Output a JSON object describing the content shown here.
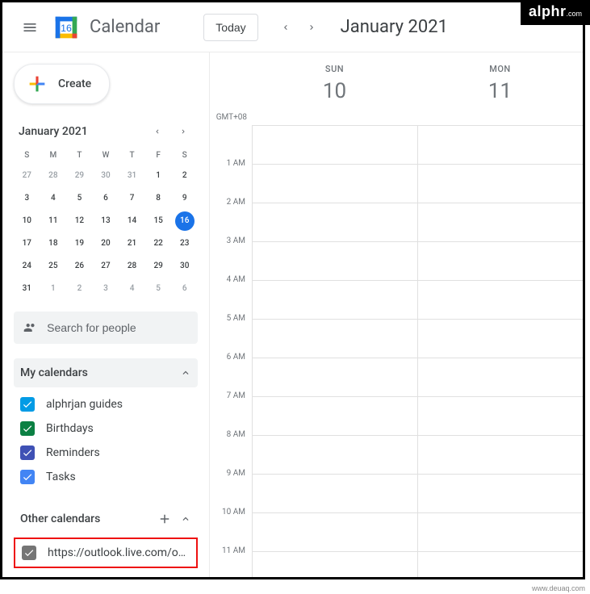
{
  "badge": {
    "brand": "alphr",
    "tld": ".com"
  },
  "watermark": "www.deuaq.com",
  "header": {
    "app_title": "Calendar",
    "today_label": "Today",
    "current_range": "January 2021"
  },
  "create_label": "Create",
  "mini_cal": {
    "title": "January 2021",
    "dow": [
      "S",
      "M",
      "T",
      "W",
      "T",
      "F",
      "S"
    ],
    "weeks": [
      [
        {
          "d": "27",
          "o": true
        },
        {
          "d": "28",
          "o": true
        },
        {
          "d": "29",
          "o": true
        },
        {
          "d": "30",
          "o": true
        },
        {
          "d": "31",
          "o": true
        },
        {
          "d": "1"
        },
        {
          "d": "2"
        }
      ],
      [
        {
          "d": "3"
        },
        {
          "d": "4"
        },
        {
          "d": "5"
        },
        {
          "d": "6"
        },
        {
          "d": "7"
        },
        {
          "d": "8"
        },
        {
          "d": "9"
        }
      ],
      [
        {
          "d": "10"
        },
        {
          "d": "11"
        },
        {
          "d": "12"
        },
        {
          "d": "13"
        },
        {
          "d": "14"
        },
        {
          "d": "15"
        },
        {
          "d": "16",
          "t": true
        }
      ],
      [
        {
          "d": "17"
        },
        {
          "d": "18"
        },
        {
          "d": "19"
        },
        {
          "d": "20"
        },
        {
          "d": "21"
        },
        {
          "d": "22"
        },
        {
          "d": "23"
        }
      ],
      [
        {
          "d": "24"
        },
        {
          "d": "25"
        },
        {
          "d": "26"
        },
        {
          "d": "27"
        },
        {
          "d": "28"
        },
        {
          "d": "29"
        },
        {
          "d": "30"
        }
      ],
      [
        {
          "d": "31"
        },
        {
          "d": "1",
          "o": true
        },
        {
          "d": "2",
          "o": true
        },
        {
          "d": "3",
          "o": true
        },
        {
          "d": "4",
          "o": true
        },
        {
          "d": "5",
          "o": true
        },
        {
          "d": "6",
          "o": true
        }
      ]
    ]
  },
  "search_placeholder": "Search for people",
  "my_calendars": {
    "title": "My calendars",
    "items": [
      {
        "label": "alphrjan guides",
        "color": "#039be5"
      },
      {
        "label": "Birthdays",
        "color": "#0b8043"
      },
      {
        "label": "Reminders",
        "color": "#3f51b5"
      },
      {
        "label": "Tasks",
        "color": "#4285f4"
      }
    ]
  },
  "other_calendars": {
    "title": "Other calendars",
    "highlighted_item": {
      "label": "https://outlook.live.com/o…",
      "color": "#757575"
    }
  },
  "timezone": "GMT+08",
  "days": [
    {
      "dow": "SUN",
      "num": "10"
    },
    {
      "dow": "MON",
      "num": "11"
    }
  ],
  "hours": [
    "",
    "1 AM",
    "2 AM",
    "3 AM",
    "4 AM",
    "5 AM",
    "6 AM",
    "7 AM",
    "8 AM",
    "9 AM",
    "10 AM",
    "11 AM"
  ]
}
